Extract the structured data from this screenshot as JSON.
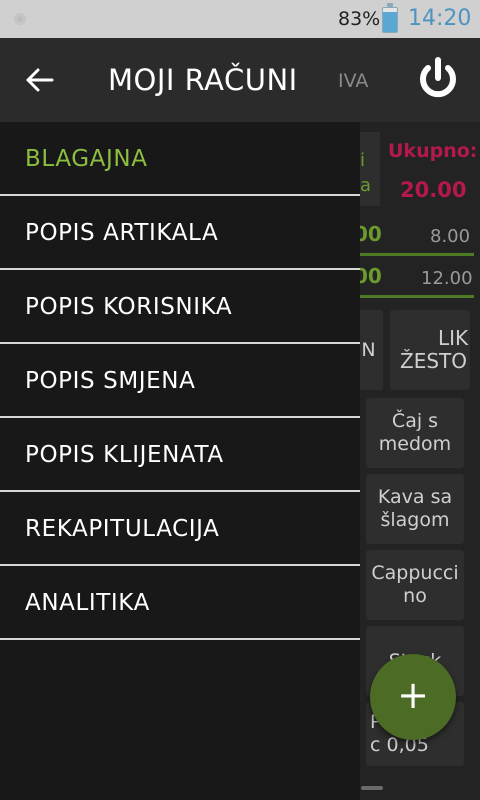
{
  "status_bar": {
    "battery_percent": "83%",
    "time": "14:20"
  },
  "action_bar": {
    "title": "MOJI RAČUNI",
    "iva_label": "IVA",
    "back_icon": "arrow-left-icon",
    "power_icon": "power-icon"
  },
  "drawer": {
    "items": [
      {
        "label": "BLAGAJNA",
        "active": true
      },
      {
        "label": "POPIS ARTIKALA",
        "active": false
      },
      {
        "label": "POPIS KORISNIKA",
        "active": false
      },
      {
        "label": "POPIS SMJENA",
        "active": false
      },
      {
        "label": "POPIS KLIJENATA",
        "active": false
      },
      {
        "label": "REKAPITULACIJA",
        "active": false
      },
      {
        "label": "ANALITIKA",
        "active": false
      }
    ],
    "active_color": "#8cbf3f"
  },
  "background": {
    "prev_text_1": "i",
    "prev_text_2": "a",
    "ukupno_label": "Ukupno:",
    "ukupno_value": "20.00",
    "row1_left": "00",
    "row1_right": "8.00",
    "row2_left": "00",
    "row2_right": "12.00",
    "card_n": "N",
    "card_lik_1": "LIK",
    "card_lik_2": "ŽESTO",
    "products": [
      {
        "line1": "Čaj s",
        "line2": "medom"
      },
      {
        "line1": "Kava sa",
        "line2": "šlagom"
      },
      {
        "line1": "Cappucci",
        "line2": "no"
      },
      {
        "line1": "Stock",
        "line2": ""
      },
      {
        "line1": "P",
        "line2": "c 0,05"
      }
    ],
    "accent_red": "#b5194b",
    "accent_green": "#6b9a2e"
  },
  "fab": {
    "label": "+",
    "icon": "plus-icon"
  }
}
